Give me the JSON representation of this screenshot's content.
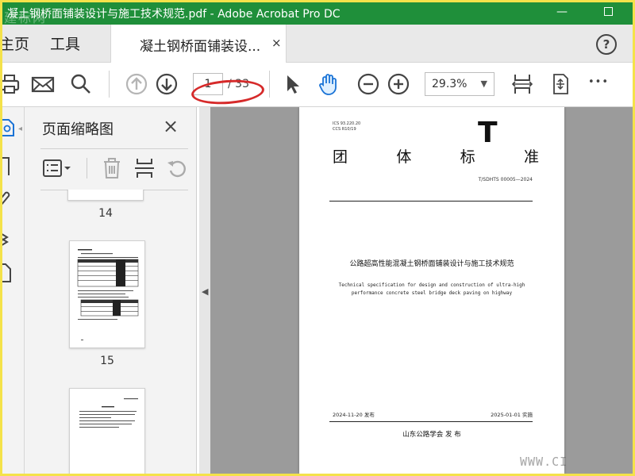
{
  "window": {
    "title": "凝土钢桥面铺装设计与施工技术规范.pdf - Adobe Acrobat Pro DC",
    "watermark_logo": "建标网",
    "accent_color": "#1f8f3a"
  },
  "tabs": {
    "home": "主页",
    "tools": "工具",
    "document": "凝土钢桥面铺装设...",
    "close_symbol": "×",
    "help_symbol": "?"
  },
  "toolbar": {
    "current_page": "1",
    "total_pages": "/ 33",
    "zoom": "29.3%",
    "more_symbol": "•••",
    "annotation_color": "#d62a2a",
    "icons": [
      "print-icon",
      "email-icon",
      "search-icon",
      "page-up-icon",
      "page-down-icon",
      "select-arrow-icon",
      "hand-tool-icon",
      "zoom-out-icon",
      "zoom-in-icon",
      "fit-page-icon",
      "scroll-mode-icon",
      "more-icon"
    ]
  },
  "thumbnail_panel": {
    "title": "页面缩略图",
    "close_symbol": "×",
    "pages": [
      "14",
      "15"
    ]
  },
  "document_page": {
    "ics": "ICS 93.220.20",
    "ccs": "CCS R10/19",
    "category_letter": "T",
    "standard_type_chars": [
      "团",
      "体",
      "标",
      "准"
    ],
    "standard_number": "T/SDHTS 00005—2024",
    "title_cn": "公路超高性能混凝土钢桥面铺装设计与施工技术规范",
    "title_en": "Technical specification for design and construction of ultra-high performance concrete steel bridge deck paving on highway",
    "publish_date": "2024-11-20 发布",
    "implement_date": "2025-01-01 实施",
    "publisher": "山东公路学会   发 布"
  },
  "watermark_bottom": "WWW.CI"
}
